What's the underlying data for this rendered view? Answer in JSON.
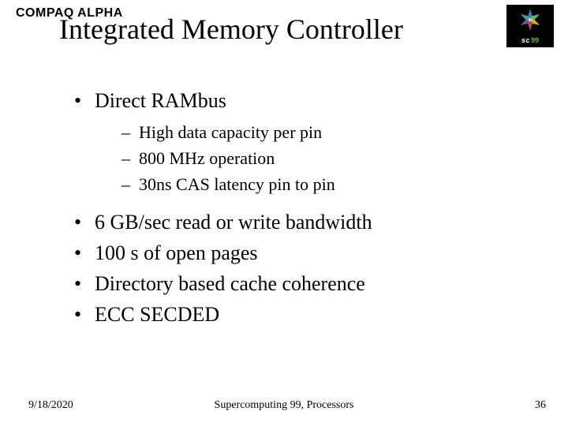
{
  "brand": "COMPAQ ALPHA",
  "title": "Integrated Memory Controller",
  "logo": {
    "sc": "sc",
    "year": "99"
  },
  "bullets": [
    {
      "text": "Direct RAMbus",
      "sub": [
        "High data capacity per pin",
        "800 MHz operation",
        "30ns CAS latency pin to pin"
      ]
    },
    {
      "text": "6 GB/sec read or write bandwidth"
    },
    {
      "text": "100 s of open pages"
    },
    {
      "text": "Directory based cache coherence"
    },
    {
      "text": "ECC SECDED"
    }
  ],
  "footer": {
    "date": "9/18/2020",
    "middle": "Supercomputing 99, Processors",
    "page": "36"
  }
}
